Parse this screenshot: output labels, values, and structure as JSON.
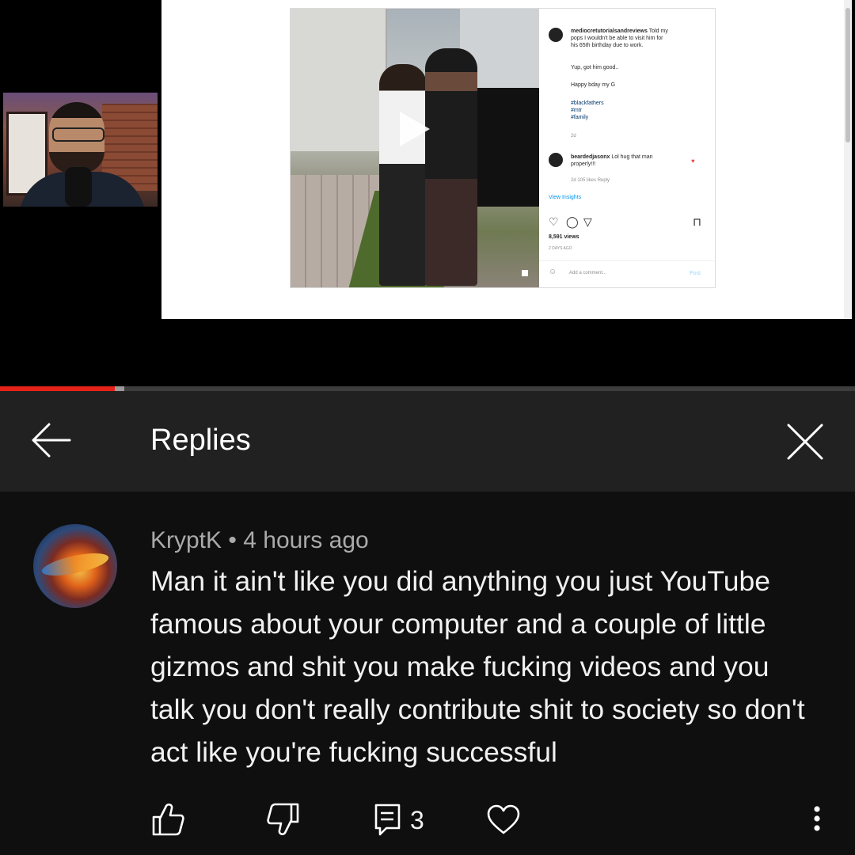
{
  "video": {
    "post": {
      "author": "mediocretutorialsandreviews",
      "caption_lines": [
        "Told my",
        "pops I wouldn't be able to visit him for",
        "his 65th birthday due to work."
      ],
      "line2": "Yup, got him good..",
      "line3": "Happy bday my G",
      "tags": [
        "#blackfathers",
        "#mtr",
        "#family"
      ],
      "age": "2d",
      "commenter": "beardedjasonx",
      "comment_text": "Lol hug that man",
      "comment_text2": "properly!!!",
      "comment_meta": "2d   105 likes   Reply",
      "view_insights": "View Insights",
      "views": "8,591 views",
      "posted": "2 DAYS AGO",
      "add_comment": "Add a comment...",
      "post_btn": "Post"
    }
  },
  "progress": {
    "played_fraction": 0.134,
    "buffered_fraction": 0.145,
    "played_color": "#e62117"
  },
  "header": {
    "title": "Replies",
    "back_icon": "arrow-left-icon",
    "close_icon": "close-icon"
  },
  "comment": {
    "author": "KryptK",
    "separator": "•",
    "time": "4 hours ago",
    "text": "Man it ain't like you did anything you just YouTube famous about your computer and a couple of little gizmos and shit you make fucking videos and you talk you don't really contribute shit to society so don't act like you're fucking successful",
    "avatar": "phoenix-avatar"
  },
  "actions": {
    "like_icon": "thumbs-up-icon",
    "dislike_icon": "thumbs-down-icon",
    "reply_icon": "reply-icon",
    "reply_count": "3",
    "heart_icon": "heart-icon",
    "more_icon": "more-vertical-icon"
  }
}
